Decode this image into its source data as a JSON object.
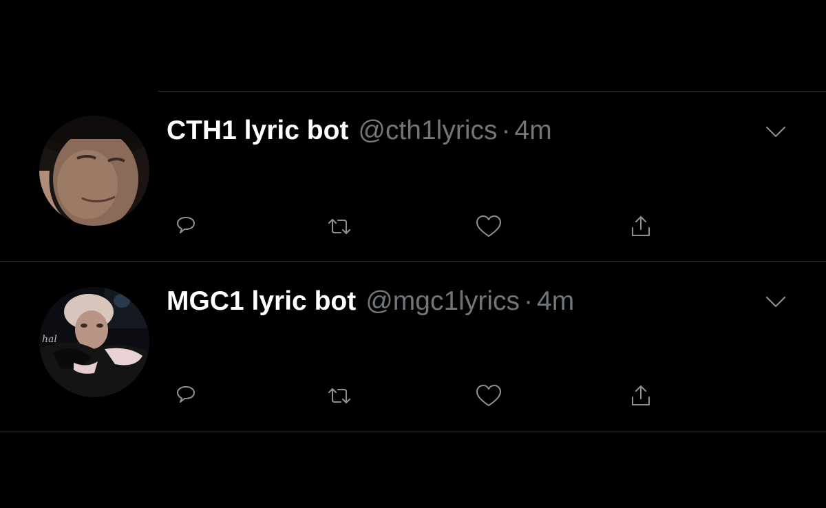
{
  "tweets": [
    {
      "display_name": "CTH1 lyric bot",
      "handle": "@cth1lyrics",
      "separator": "·",
      "time": "4m",
      "avatar_icon": "avatar-photo"
    },
    {
      "display_name": "MGC1 lyric bot",
      "handle": "@mgc1lyrics",
      "separator": "·",
      "time": "4m",
      "avatar_icon": "avatar-photo"
    }
  ],
  "actions": {
    "reply_icon": "reply-icon",
    "retweet_icon": "retweet-icon",
    "like_icon": "heart-icon",
    "share_icon": "share-icon",
    "more_icon": "chevron-down-icon"
  },
  "colors": {
    "background": "#000000",
    "name": "#ffffff",
    "secondary_text": "#71767b",
    "icon": "#8b9095",
    "divider": "#2f3336"
  }
}
